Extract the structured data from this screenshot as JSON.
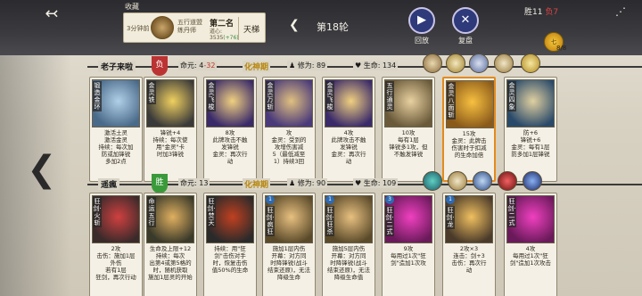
{
  "topbar": {
    "back_icon": "↢",
    "collect_label": "收藏",
    "profile": {
      "score": "3分钟前",
      "subtitle": "五行道盟 练丹师",
      "rank": "第二名",
      "dao": "道心:",
      "dao_value": "3535",
      "dao_delta": "(+76)",
      "ladder": "天梯"
    },
    "round_arrow": "❮",
    "round": "第18轮",
    "replay": {
      "icon": "▶",
      "label": "回放"
    },
    "review": {
      "icon": "✕",
      "label": "复盘"
    },
    "score_win": "胜11",
    "score_lose": "负7",
    "progress_top": "七",
    "progress_text": "8/8"
  },
  "players": [
    {
      "name": "老子来啦",
      "badge": "负",
      "life_label": "命元:",
      "life_v1": "4",
      "life_v2": "-32",
      "realm": "化神期",
      "cult_label": "修为:",
      "cult_value": "89",
      "hp_label": "生命:",
      "hp_value": "134",
      "cards": [
        {
          "title": "锻造金环",
          "lines": [
            "激活土灵",
            "激活金灵",
            "持续：每次加",
            "防或加锋锐",
            "多加2点"
          ],
          "lvl": ""
        },
        {
          "title": "金灵铁",
          "lines": [
            "锋锐+4",
            "持续：每次使",
            "用\"金灵\"卡",
            "时加3锋锐"
          ],
          "lvl": ""
        },
        {
          "title": "金灵飞梭",
          "lines": [
            "8攻",
            "此牌攻击不触",
            "发锋锐",
            "金灵：再次行",
            "动"
          ],
          "lvl": ""
        },
        {
          "title": "金灵万斩",
          "lines": [
            "攻",
            "金灵：受到的",
            "攻增伤害减",
            "5（最低减至",
            "1）持续3回"
          ],
          "lvl": ""
        },
        {
          "title": "金灵飞梭",
          "lines": [
            "4攻",
            "此牌攻击不触",
            "发锋锐",
            "金灵：再次行",
            "动"
          ],
          "lvl": ""
        },
        {
          "title": "五行通灵",
          "lines": [
            "10攻",
            "每有1层",
            "锋锐多1攻，但",
            "不触发锋锐"
          ],
          "lvl": ""
        },
        {
          "title": "金灵八面斩",
          "lines": [
            "15攻",
            "金灵：此牌击",
            "伤害时于扣减",
            "的生命加倍"
          ],
          "lvl": ""
        },
        {
          "title": "金灵四象",
          "lines": [
            "防+6",
            "锋锐+6",
            "金灵：每有1层",
            "防多加1层锋锐"
          ],
          "lvl": ""
        }
      ]
    },
    {
      "name": "遥瘋",
      "badge": "胜",
      "life_label": "命元:",
      "life_v1": "13",
      "life_v2": "",
      "realm": "化神期",
      "cult_label": "修为:",
      "cult_value": "90",
      "hp_label": "生命:",
      "hp_value": "109",
      "cards": [
        {
          "title": "狂剑·火斩",
          "lines": [
            "2攻",
            "击伤：施加1层",
            "外伤",
            "若有1层",
            "狂剑，再次行动"
          ],
          "lvl": ""
        },
        {
          "title": "命运五行",
          "lines": [
            "生命及上限+12",
            "持续：每次",
            "出第4或第5格的",
            "时，随机获取",
            "施加1层灵的开始"
          ],
          "lvl": ""
        },
        {
          "title": "狂剑·焚天",
          "lines": [
            "持续：用\"狂",
            "剑\"击伤对手",
            "时，恢复击伤",
            "值50%的生命"
          ],
          "lvl": ""
        },
        {
          "title": "狂剑·疯狂",
          "lines": [
            "施加1层内伤",
            "开幕：对方同",
            "时降锋锐(战斗",
            "结束还原)，无法",
            "降级生命"
          ],
          "lvl": "1"
        },
        {
          "title": "狂剑·狂杀",
          "lines": [
            "施加5层内伤",
            "开幕：对方同",
            "时降锋锐(战斗",
            "结束还原)，无法",
            "降级生命值"
          ],
          "lvl": "1"
        },
        {
          "title": "狂剑·二式",
          "lines": [
            "9攻",
            "每用过1次\"狂",
            "剑\"造加1次攻"
          ],
          "lvl": "3"
        },
        {
          "title": "狂剑·龙",
          "lines": [
            "2攻×3",
            "连击：剑+3",
            "击伤：再次行",
            "动"
          ],
          "lvl": "1"
        },
        {
          "title": "狂剑·二式",
          "lines": [
            "4攻",
            "每用过1次\"狂",
            "剑\"造加1次攻击"
          ],
          "lvl": ""
        }
      ]
    }
  ],
  "left_arrow": "❮"
}
